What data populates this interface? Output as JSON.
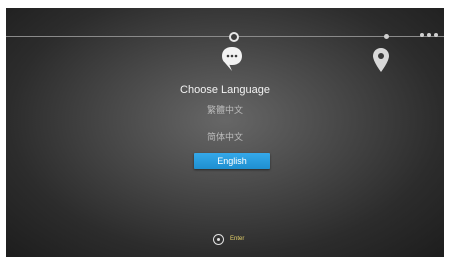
{
  "setup": {
    "title": "Choose Language",
    "languages": [
      {
        "label": "繁體中文",
        "selected": false
      },
      {
        "label": "简体中文",
        "selected": false
      },
      {
        "label": "English",
        "selected": true
      }
    ],
    "hint": {
      "icon": "enter-icon",
      "label": "Enter"
    }
  },
  "progress": {
    "current_step_icon": "chat-bubble-icon",
    "next_step_icon": "location-pin-icon",
    "more_icon": "more-dots-icon"
  },
  "colors": {
    "accent": "#2a9fe2",
    "hint_text": "#e7d36a",
    "title_text": "#f2f2f2",
    "option_text": "#bcbcbc"
  }
}
